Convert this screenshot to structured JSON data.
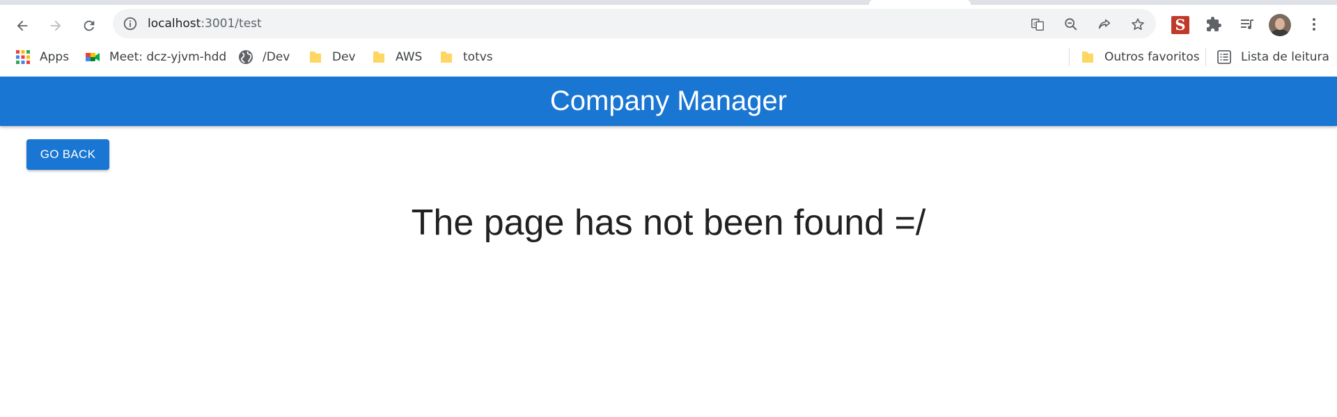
{
  "browser": {
    "url_host": "localhost",
    "url_path": ":3001/test",
    "icons": {
      "back": "back-arrow-icon",
      "forward": "forward-arrow-icon",
      "reload": "reload-icon",
      "site_info": "info-icon",
      "translate": "translate-icon",
      "zoom": "zoom-out-icon",
      "share": "share-icon",
      "bookmark": "star-icon",
      "extensions": "puzzle-icon",
      "media": "media-queue-icon",
      "menu": "kebab-menu-icon"
    },
    "extension_letter": "S"
  },
  "bookmarks": {
    "items": [
      {
        "label": "Apps",
        "icon": "apps-grid-icon"
      },
      {
        "label": "Meet: dcz-yjvm-hdd",
        "icon": "meet-icon"
      },
      {
        "label": "/Dev",
        "icon": "globe-icon"
      },
      {
        "label": "Dev",
        "icon": "folder-icon"
      },
      {
        "label": "AWS",
        "icon": "folder-icon"
      },
      {
        "label": "totvs",
        "icon": "folder-icon"
      }
    ],
    "other": "Outros favoritos",
    "reading_list": "Lista de leitura"
  },
  "page": {
    "title": "Company Manager",
    "go_back_label": "GO BACK",
    "message": "The page has not been found =/"
  },
  "colors": {
    "primary": "#1976d2",
    "folder": "#fdd663"
  }
}
